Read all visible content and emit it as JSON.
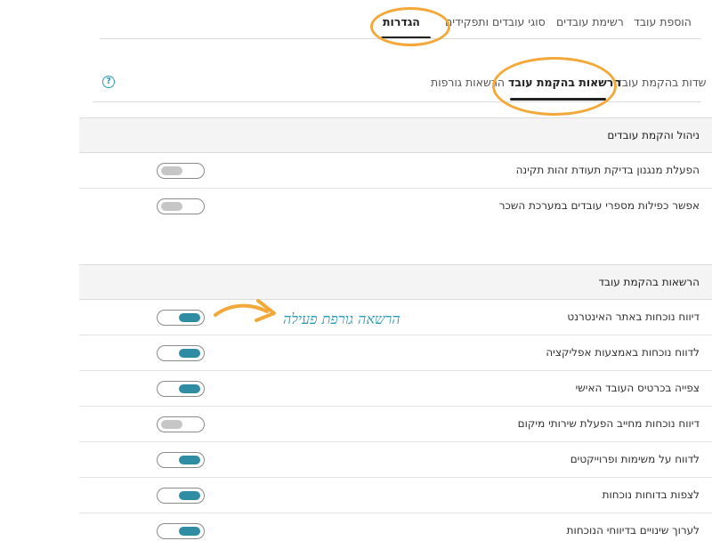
{
  "top_tabs": [
    {
      "label": "הוספת עובד"
    },
    {
      "label": "רשימת עובדים"
    },
    {
      "label": "סוגי עובדים ותפקידים"
    },
    {
      "label": "הגדרות"
    }
  ],
  "sub_tabs": [
    {
      "label": "שדות בהקמת עובד"
    },
    {
      "label": "הרשאות בהקמת עובד"
    },
    {
      "label": "הרשאות גורפות"
    }
  ],
  "help_icon": {
    "symbol": "?"
  },
  "section1": {
    "title": "ניהול והקמת עובדים",
    "rows": [
      {
        "label": "הפעלת מנגנון בדיקת תעודת זהות תקינה",
        "enabled": false
      },
      {
        "label": "אפשר כפילות מספרי עובדים במערכת השכר",
        "enabled": false
      }
    ]
  },
  "section2": {
    "title": "הרשאות בהקמת עובד",
    "rows": [
      {
        "label": "דיווח נוכחות באתר האינטרנט",
        "enabled": true
      },
      {
        "label": "לדווח נוכחות באמצעות אפליקציה",
        "enabled": true
      },
      {
        "label": "צפייה בכרטיס העובד האישי",
        "enabled": true
      },
      {
        "label": "דיווח נוכחות מחייב הפעלת שירותי מיקום",
        "enabled": false
      },
      {
        "label": "לדווח על משימות ופרוייקטים",
        "enabled": true
      },
      {
        "label": "לצפות בדוחות נוכחות",
        "enabled": true
      },
      {
        "label": "לערוך שינויים בדיווחי הנוכחות",
        "enabled": true
      }
    ]
  },
  "annotation": {
    "text": "הרשאה גורפת פעילה"
  },
  "colors": {
    "accent": "#2e8da3",
    "highlight": "#f3a93a",
    "toggle_off": "#c6c6c6"
  }
}
